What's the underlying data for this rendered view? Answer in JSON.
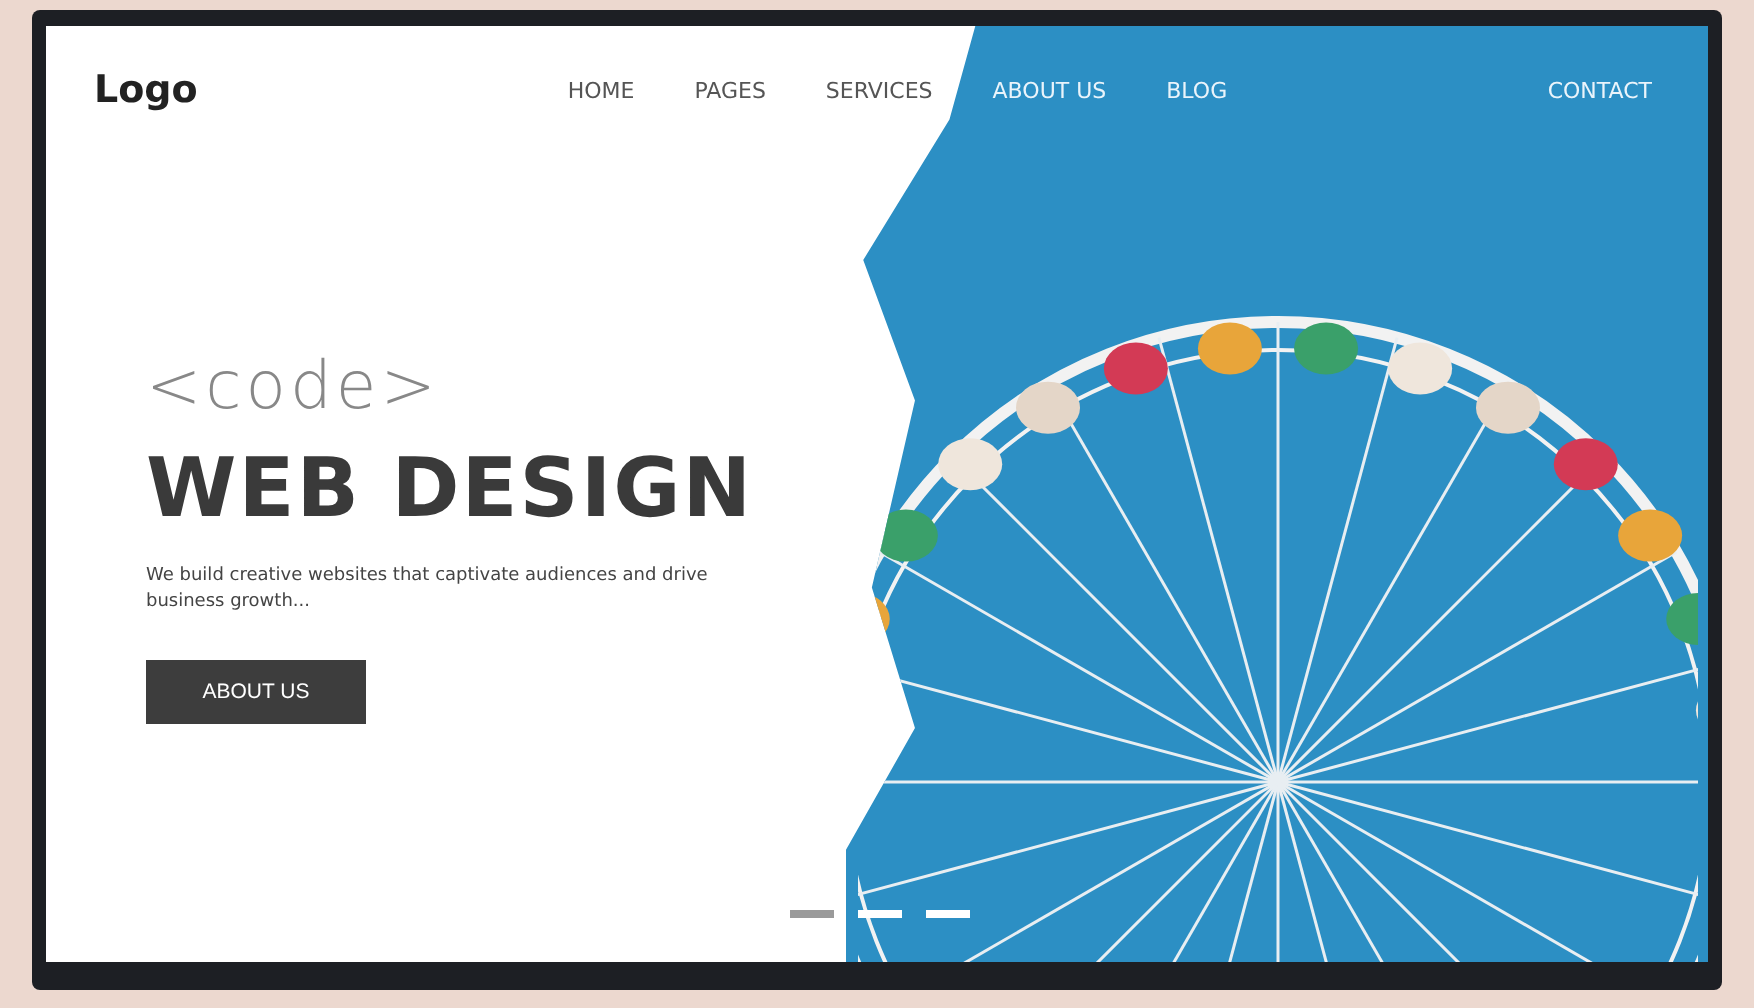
{
  "logo": "Logo",
  "nav": [
    {
      "label": "HOME"
    },
    {
      "label": "PAGES"
    },
    {
      "label": "SERVICES"
    },
    {
      "label": "ABOUT US"
    },
    {
      "label": "BLOG"
    }
  ],
  "contact": "CONTACT",
  "hero": {
    "tag": "<code>",
    "title": "WEB DESIGN",
    "text": "We build creative websites that captivate audiences and drive business growth...",
    "button": "ABOUT US"
  },
  "slides": [
    {
      "selected": true
    },
    {
      "selected": false
    },
    {
      "selected": false
    }
  ]
}
